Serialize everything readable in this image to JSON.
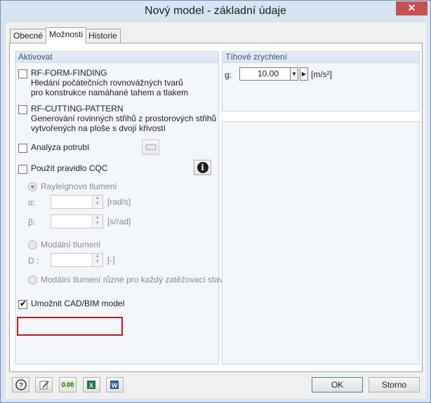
{
  "window": {
    "title": "Nový model - základní údaje",
    "close_glyph": "✕"
  },
  "tabs": [
    {
      "label": "Obecné",
      "active": false
    },
    {
      "label": "Možnosti",
      "active": true
    },
    {
      "label": "Historie",
      "active": false
    }
  ],
  "activate": {
    "header": "Aktivovat",
    "form_finding": {
      "title": "RF-FORM-FINDING",
      "line1": "Hledání počátečních rovnovážných tvarů",
      "line2": "pro konstrukce namáhané tahem a tlakem",
      "checked": false
    },
    "cutting_pattern": {
      "title": "RF-CUTTING-PATTERN",
      "line1": "Generování rovinných střihů z prostorových střihů",
      "line2": "vytvořených na ploše s dvojí křivostí",
      "checked": false
    },
    "pipe_analysis": {
      "label": "Analýza potrubí",
      "checked": false,
      "icon": "pipe-settings-icon"
    },
    "cqc": {
      "label": "Použít pravidlo CQC",
      "checked": false,
      "icon": "info-icon",
      "icon_glyph": "i"
    },
    "rayleigh": {
      "label": "Rayleighovo tlumení",
      "alpha_symbol": "α:",
      "alpha_unit": "[rad/s]",
      "beta_symbol": "β:",
      "beta_unit": "[s/rad]"
    },
    "modal": {
      "label": "Modální tlumení",
      "d_symbol": "D :",
      "d_unit": "[-]"
    },
    "modal_per_case": {
      "label": "Modální tlumení různé pro každý zatěžovací stav"
    },
    "cad_bim": {
      "label": "Umožnit CAD/BIM model",
      "checked": true
    }
  },
  "gravity": {
    "header": "Tíhové zrychlení",
    "symbol": "g:",
    "value": "10.00",
    "unit": "[m/s²]"
  },
  "footer": {
    "ok_label": "OK",
    "cancel_label": "Storno",
    "icons": [
      "help-icon",
      "edit-icon",
      "units-icon",
      "excel-export-icon",
      "word-export-icon"
    ],
    "units_glyph": "0.00"
  },
  "colors": {
    "highlight": "#c0161e",
    "title_bar": "#d7e4f2",
    "group_header_text": "#3b5577"
  }
}
